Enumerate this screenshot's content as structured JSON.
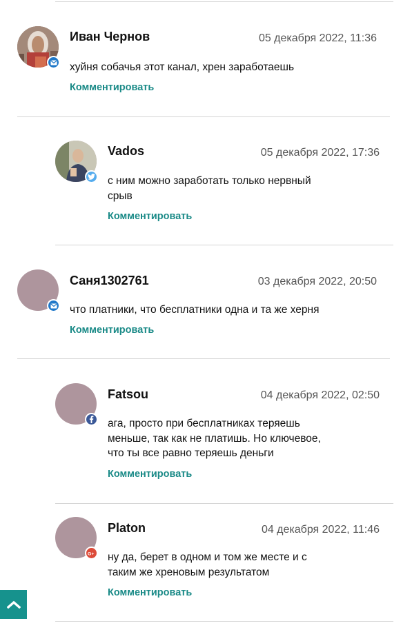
{
  "comments": [
    {
      "author": "Иван Чернов",
      "date": "05 декабря 2022, 11:36",
      "text": "хуйня собачья этот канал, хрен заработаешь",
      "reply_label": "Комментировать",
      "source_icon": "mail-icon",
      "source_color": "#1f78c9"
    },
    {
      "author": "Vados",
      "date": "05 декабря 2022, 17:36",
      "text": "с ним можно заработать только нервный срыв",
      "reply_label": "Комментировать",
      "source_icon": "twitter-icon",
      "source_color": "#55acee"
    },
    {
      "author": "Саня1302761",
      "date": "03 декабря 2022, 20:50",
      "text": "что платники, что бесплатники одна и та же херня",
      "reply_label": "Комментировать",
      "source_icon": "mail-icon",
      "source_color": "#1f78c9"
    },
    {
      "author": "Fatsou",
      "date": "04 декабря 2022, 02:50",
      "text": "ага, просто при бесплатниках теряешь меньше, так как не платишь. Но ключевое, что ты все равно теряешь деньги",
      "reply_label": "Комментировать",
      "source_icon": "facebook-icon",
      "source_color": "#3b5998"
    },
    {
      "author": "Platon",
      "date": "04 декабря 2022, 11:46",
      "text": "ну да, берет в одном и том же месте и с таким же хреновым результатом",
      "reply_label": "Комментировать",
      "source_icon": "google-plus-icon",
      "source_color": "#dd4b39"
    }
  ],
  "placeholder_avatar_color": "#ae959d",
  "accent_color": "#1a8a87",
  "scroll_top_icon": "chevron-up-icon"
}
